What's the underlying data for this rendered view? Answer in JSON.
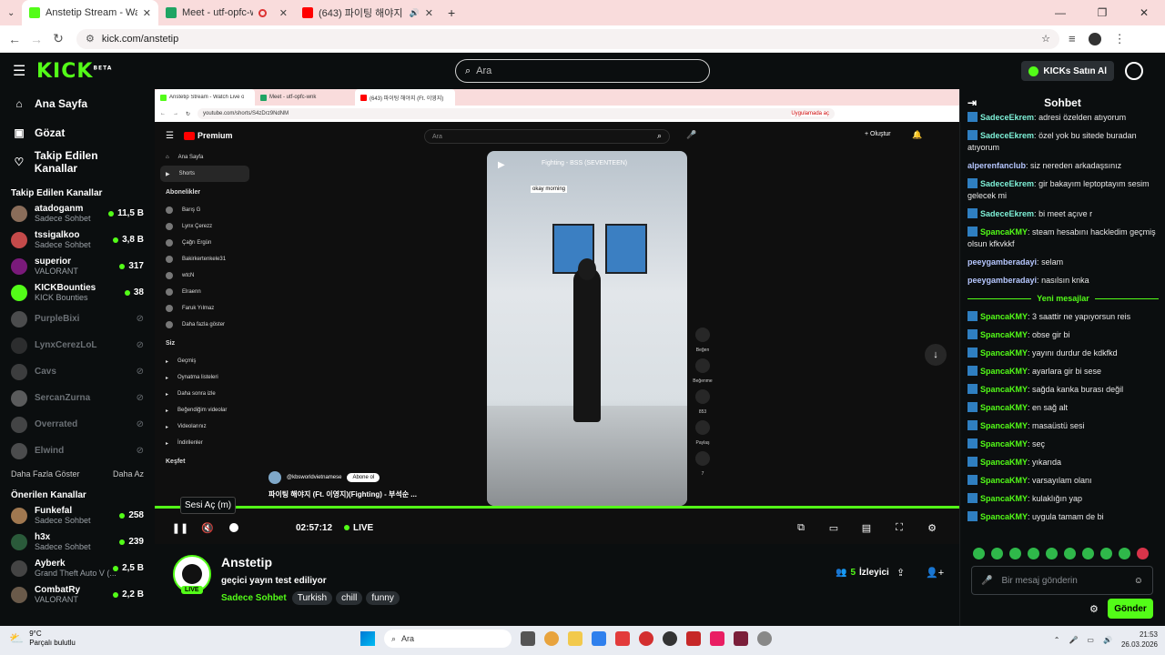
{
  "browser": {
    "tabs": [
      {
        "title": "Anstetip Stream - Watch Live o",
        "color": "#53fc18",
        "active": true
      },
      {
        "title": "Meet - utf-opfc-wnk",
        "color": "#1fa463",
        "active": false
      },
      {
        "title": "(643) 파이팅 해야지 (Ft. 이",
        "color": "#ff0000",
        "active": false
      }
    ],
    "url": "kick.com/anstetip"
  },
  "header": {
    "logo": "KICK",
    "logo_sup": "BETA",
    "search_placeholder": "Ara",
    "kicks_button": "KICKs Satın Al"
  },
  "sidebar": {
    "nav": [
      {
        "label": "Ana Sayfa",
        "icon": "home-icon"
      },
      {
        "label": "Gözat",
        "icon": "browse-icon"
      },
      {
        "label": "Takip Edilen Kanallar",
        "icon": "heart-icon"
      }
    ],
    "followed_title": "Takip Edilen Kanallar",
    "followed": [
      {
        "name": "atadoganm",
        "sub": "Sadece Sohbet",
        "viewers": "11,5 B",
        "color": "#8a6d5a"
      },
      {
        "name": "tssigalkoo",
        "sub": "Sadece Sohbet",
        "viewers": "3,8 B",
        "color": "#c44a4a"
      },
      {
        "name": "superior",
        "sub": "VALORANT",
        "viewers": "317",
        "color": "#7a1a7a"
      },
      {
        "name": "KICKBounties",
        "sub": "KICK Bounties",
        "viewers": "38",
        "color": "#53fc18"
      }
    ],
    "offline": [
      {
        "name": "PurpleBixi",
        "color": "#9a9a9a"
      },
      {
        "name": "LynxCerezLoL",
        "color": "#555"
      },
      {
        "name": "Cavs",
        "color": "#777"
      },
      {
        "name": "SercanZurna",
        "color": "#bbb"
      },
      {
        "name": "Overrated",
        "color": "#888"
      },
      {
        "name": "Elwind",
        "color": "#999"
      }
    ],
    "show_more": "Daha Fazla Göster",
    "show_less": "Daha Az",
    "suggested_title": "Önerilen Kanallar",
    "suggested": [
      {
        "name": "Funkefal",
        "sub": "Sadece Sohbet",
        "viewers": "258",
        "color": "#a07850"
      },
      {
        "name": "h3x",
        "sub": "Sadece Sohbet",
        "viewers": "239",
        "color": "#2a5a3a"
      },
      {
        "name": "Ayberk",
        "sub": "Grand Theft Auto V (...",
        "viewers": "2,5 B",
        "color": "#444"
      },
      {
        "name": "CombatRy",
        "sub": "VALORANT",
        "viewers": "2,2 B",
        "color": "#6a5a4a"
      }
    ]
  },
  "player": {
    "inner_tabs": [
      "Anstetip Stream - Watch Live o",
      "Meet - utf-opfc-wnk",
      "(643) 파이팅 해야지 (Ft. 이영지)"
    ],
    "inner_url": "youtube.com/shorts/S4zDrz9NdNM",
    "inner_app_btn": "Uygulamada aç",
    "yt_logo": "Premium",
    "yt_search": "Ara",
    "yt_create": "Oluştur",
    "yt_side": [
      {
        "label": "Ana Sayfa"
      },
      {
        "label": "Shorts",
        "sel": true
      }
    ],
    "yt_subs_title": "Abonelikler",
    "yt_subs": [
      "Barış G",
      "Lynx Çerezz",
      "Çağrı Ergün",
      "Bakirkertenkele31",
      "wtcN",
      "Elraenn",
      "Faruk Yılmaz",
      "Daha fazla göster"
    ],
    "yt_you_title": "Siz",
    "yt_you": [
      "Geçmiş",
      "Oynatma listeleri",
      "Daha sonra izle",
      "Beğendiğim videolar",
      "Videolarınız",
      "İndirilenler"
    ],
    "yt_explore": "Keşfet",
    "video_okay": "okay morning",
    "video_caption": "Fighting - BSS (SEVENTEEN)",
    "actions": [
      "Beğen",
      "Beğenme",
      "853",
      "Paylaş",
      "7"
    ],
    "channel": "@kbsworldvietnamese",
    "subscribe": "Abone ol",
    "short_title": "파이팅 해야지 (Ft. 이영지)(Fighting) - 부석순 ...",
    "tooltip": "Sesi Aç (m)",
    "time": "02:57:12",
    "live": "LIVE",
    "progress_pct": 100
  },
  "stream": {
    "name": "Anstetip",
    "title": "geçici yayın test ediliyor",
    "live_badge": "LIVE",
    "category": "Sadece Sohbet",
    "tags": [
      "Turkish",
      "chill",
      "funny"
    ],
    "viewers_num": "5",
    "viewers_label": "İzleyici"
  },
  "chat": {
    "title": "Sohbet",
    "messages": [
      {
        "user": "SadeceEkrem",
        "text": "adresi özelden atıyorum",
        "badge": true,
        "cls": "u1"
      },
      {
        "user": "SadeceEkrem",
        "text": "özel yok bu sitede buradan atıyorum",
        "badge": true,
        "cls": "u1"
      },
      {
        "user": "alperenfanclub",
        "text": "siz nereden arkadaşsınız",
        "badge": false,
        "cls": "u2"
      },
      {
        "user": "SadeceEkrem",
        "text": "gir bakayım leptoptayım sesim gelecek mi",
        "badge": true,
        "cls": "u1"
      },
      {
        "user": "SadeceEkrem",
        "text": "bi meet açıve r",
        "badge": true,
        "cls": "u1"
      },
      {
        "user": "SpancaKMY",
        "text": "steam hesabını hackledim geçmiş olsun kfkvkkf",
        "badge": true,
        "cls": "u3"
      },
      {
        "user": "peeygamberadayi",
        "text": "selam",
        "badge": false,
        "cls": "u2"
      },
      {
        "user": "peeygamberadayi",
        "text": "nasılsın knka",
        "badge": false,
        "cls": "u2"
      }
    ],
    "new_label": "Yeni mesajlar",
    "new_messages": [
      {
        "user": "SpancaKMY",
        "text": "3 saattir ne yapıyorsun reis"
      },
      {
        "user": "SpancaKMY",
        "text": "obse gir bi"
      },
      {
        "user": "SpancaKMY",
        "text": "yayını durdur de kdkfkd"
      },
      {
        "user": "SpancaKMY",
        "text": "ayarlara gir bi sese"
      },
      {
        "user": "SpancaKMY",
        "text": "sağda kanka burası değil"
      },
      {
        "user": "SpancaKMY",
        "text": "en sağ alt"
      },
      {
        "user": "SpancaKMY",
        "text": "masaüstü sesi"
      },
      {
        "user": "SpancaKMY",
        "text": "seç"
      },
      {
        "user": "SpancaKMY",
        "text": "yıkarıda"
      },
      {
        "user": "SpancaKMY",
        "text": "varsayılam olanı"
      },
      {
        "user": "SpancaKMY",
        "text": "kulaklığın yap"
      },
      {
        "user": "SpancaKMY",
        "text": "uygula tamam de bi"
      }
    ],
    "placeholder": "Bir mesaj gönderin",
    "send": "Gönder"
  },
  "taskbar": {
    "temp": "9°C",
    "weather": "Parçalı bulutlu",
    "search": "Ara",
    "time": "21:53",
    "date": "26.03.2026"
  }
}
